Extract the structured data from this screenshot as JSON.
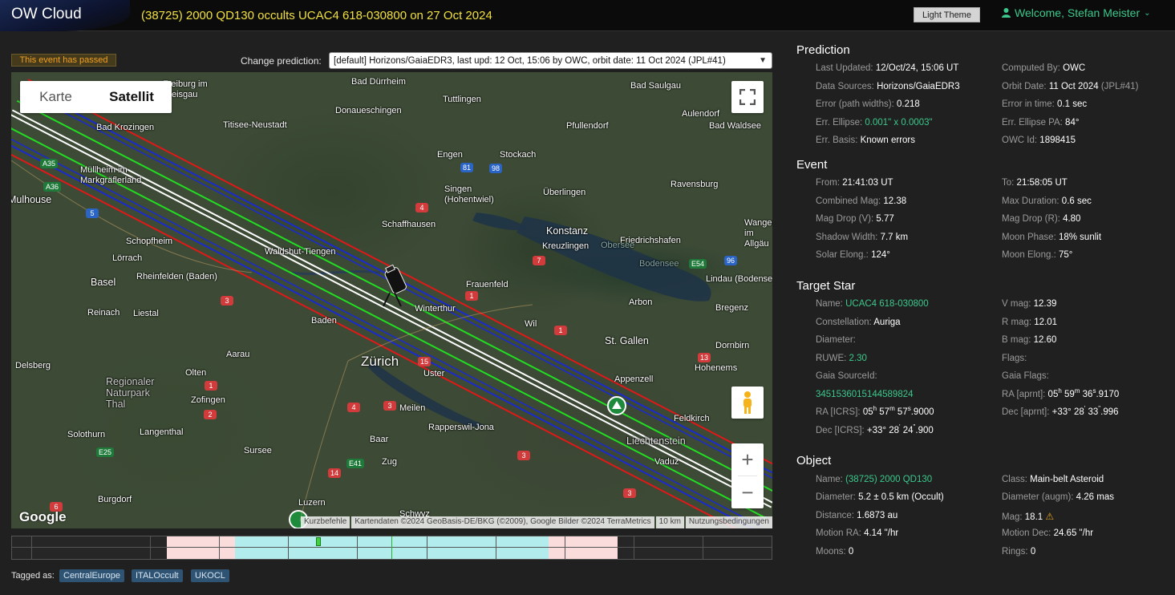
{
  "header": {
    "logo": "OW Cloud",
    "event_title": "(38725) 2000 QD130 occults UCAC4 618-030800 on 27 Oct 2024",
    "theme_button": "Light Theme",
    "user_greeting": "Welcome, Stefan Meister"
  },
  "left": {
    "passed_badge": "This event has passed",
    "change_label": "Change prediction:",
    "prediction_selected": "[default] Horizons/GaiaEDR3, last upd: 12 Oct, 15:06 by OWC, orbit date: 11 Oct 2024 (JPL#41)"
  },
  "map": {
    "type_buttons": [
      "Karte",
      "Satellit"
    ],
    "google": "Google",
    "footer": [
      "Kurzbefehle",
      "Kartendaten ©2024 GeoBasis-DE/BKG (©2009), Google Bilder ©2024 TerraMetrics",
      "10 km",
      "Nutzungsbedingungen"
    ],
    "labels": [
      "Zürich",
      "Konstanz",
      "Winterthur",
      "Basel",
      "St. Gallen",
      "Schaffhausen",
      "Lörrach",
      "Waldshut-Tiengen",
      "Frauenfeld",
      "Arbon",
      "Lindau (Bodensee)",
      "Bregenz",
      "Appenzell",
      "Dornbirn",
      "Hohenems",
      "Feldkirch",
      "Liechtenstein",
      "Vaduz",
      "Luzern",
      "Zug",
      "Baar",
      "Uster",
      "Meilen",
      "Rapperswil-Jona",
      "Aarau",
      "Olten",
      "Zofingen",
      "Langenthal",
      "Solothurn",
      "Delsberg",
      "Regionaler Naturpark Thal",
      "Reinach",
      "Liestal",
      "Rheinfelden (Baden)",
      "Schopfheim",
      "Mulhouse",
      "Müllheim im Markgräflerland",
      "Bad Krozingen",
      "Titisee-Neustadt",
      "Donaueschingen",
      "Tuttlingen",
      "Bad Saulgau",
      "Pfullendorf",
      "Aulendorf",
      "Bad Waldsee",
      "Ravensburg",
      "Überlingen",
      "Friedrichshafen",
      "Kreuzlingen",
      "Singen (Hohentwiel)",
      "Engen",
      "Stockach",
      "Sursee",
      "Burgdorf",
      "Schwyz",
      "Wil",
      "Baden",
      "Wangen im Allgäu",
      "Bad Dürrheim",
      "Freiburg im Breisgau",
      "Obersee",
      "Bodensee"
    ],
    "shields": {
      "red": [
        "4",
        "7",
        "1",
        "3",
        "1",
        "15",
        "3",
        "4",
        "1",
        "2",
        "3",
        "14",
        "6",
        "13",
        "3"
      ],
      "blue": [
        "5",
        "81",
        "98",
        "96"
      ],
      "green": [
        "A35",
        "A36",
        "E54",
        "E41",
        "E25"
      ]
    }
  },
  "timeline": {
    "ticks": 11
  },
  "tags": {
    "label": "Tagged as:",
    "items": [
      "CentralEurope",
      "ITALOccult",
      "UKOCL"
    ]
  },
  "prediction": {
    "title": "Prediction",
    "last_updated_label": "Last Updated:",
    "last_updated": "12/Oct/24, 15:06 UT",
    "computed_by_label": "Computed By:",
    "computed_by": "OWC",
    "data_sources_label": "Data Sources:",
    "data_sources": "Horizons/GaiaEDR3",
    "orbit_date_label": "Orbit Date:",
    "orbit_date": "11 Oct 2024",
    "orbit_jpl": "(JPL#41)",
    "error_path_label": "Error (path widths):",
    "error_path": "0.218",
    "error_time_label": "Error in time:",
    "error_time": "0.1 sec",
    "err_ellipse_label": "Err. Ellipse:",
    "err_ellipse": "0.001\" x 0.0003\"",
    "err_ellipse_pa_label": "Err. Ellipse PA:",
    "err_ellipse_pa": "84°",
    "err_basis_label": "Err. Basis:",
    "err_basis": "Known errors",
    "owc_id_label": "OWC Id:",
    "owc_id": "1898415"
  },
  "event": {
    "title": "Event",
    "from_label": "From:",
    "from": "21:41:03 UT",
    "to_label": "To:",
    "to": "21:58:05 UT",
    "combined_mag_label": "Combined Mag:",
    "combined_mag": "12.38",
    "max_duration_label": "Max Duration:",
    "max_duration": "0.6 sec",
    "mag_drop_v_label": "Mag Drop (V):",
    "mag_drop_v": "5.77",
    "mag_drop_r_label": "Mag Drop (R):",
    "mag_drop_r": "4.80",
    "shadow_width_label": "Shadow Width:",
    "shadow_width": "7.7 km",
    "moon_phase_label": "Moon Phase:",
    "moon_phase": "18% sunlit",
    "solar_elong_label": "Solar Elong.:",
    "solar_elong": "124°",
    "moon_elong_label": "Moon Elong.:",
    "moon_elong": "75°"
  },
  "star": {
    "title": "Target Star",
    "name_label": "Name:",
    "name": "UCAC4 618-030800",
    "vmag_label": "V mag:",
    "vmag": "12.39",
    "constellation_label": "Constellation:",
    "constellation": "Auriga",
    "rmag_label": "R mag:",
    "rmag": "12.01",
    "diameter_label": "Diameter:",
    "bmag_label": "B mag:",
    "bmag": "12.60",
    "ruwe_label": "RUWE:",
    "ruwe": "2.30",
    "flags_label": "Flags:",
    "gaia_source_label": "Gaia SourceId:",
    "gaia_source": "3451536015144589824",
    "gaia_flags_label": "Gaia Flags:",
    "ra_aprnt_label": "RA [aprnt]:",
    "ra_icrs_label": "RA [ICRS]:",
    "dec_aprnt_label": "Dec [aprnt]:",
    "dec_icrs_label": "Dec [ICRS]:"
  },
  "object": {
    "title": "Object",
    "name_label": "Name:",
    "name": "(38725) 2000 QD130",
    "class_label": "Class:",
    "class": "Main-belt Asteroid",
    "diameter_label": "Diameter:",
    "diameter": "5.2 ± 0.5 km",
    "diameter_src": "(Occult)",
    "diameter_augm_label": "Diameter (augm):",
    "diameter_augm": "4.26 mas",
    "distance_label": "Distance:",
    "distance": "1.6873 au",
    "mag_label": "Mag:",
    "mag": "18.1",
    "motion_ra_label": "Motion RA:",
    "motion_ra": "4.14 \"/hr",
    "motion_dec_label": "Motion Dec:",
    "motion_dec": "24.65 \"/hr",
    "moons_label": "Moons:",
    "moons": "0",
    "rings_label": "Rings:",
    "rings": "0"
  },
  "colors": {
    "accent_green": "#3cc88c",
    "title_yellow": "#f0e040",
    "path_center": "#ffffff",
    "path_green": "#22dd22",
    "path_blue": "#1a2ad0",
    "path_red": "#e01818"
  }
}
